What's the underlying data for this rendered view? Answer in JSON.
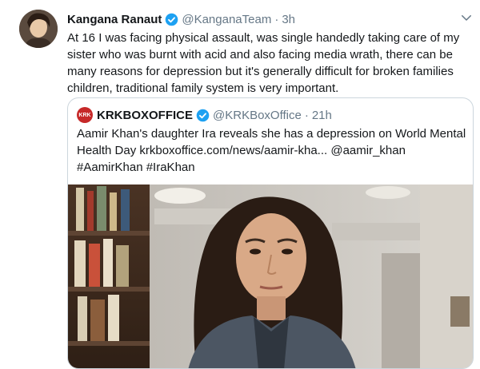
{
  "tweet": {
    "author_name": "Kangana Ranaut",
    "author_handle": "@KanganaTeam",
    "separator": "·",
    "time": "3h",
    "text": "At 16 I was facing physical assault, was single handedly taking care of my sister who was burnt with acid and also facing media wrath, there can be many reasons for depression but it's generally difficult for broken families children, traditional family system is very important."
  },
  "quoted": {
    "author_name": "KRKBOXOFFICE",
    "author_handle": "@KRKBoxOffice",
    "separator": "·",
    "time": "21h",
    "avatar_text": "KRK",
    "text_line1": "Aamir Khan's daughter Ira reveals she has a depression on World Mental",
    "text_line2": "Health Day krkboxoffice.com/news/aamir-kha... @aamir_khan",
    "text_line3": "#AamirKhan #IraKhan"
  },
  "colors": {
    "verified": "#1da1f2",
    "secondary_text": "#657786",
    "border": "#ccd6dd",
    "krk_red": "#c62828"
  }
}
